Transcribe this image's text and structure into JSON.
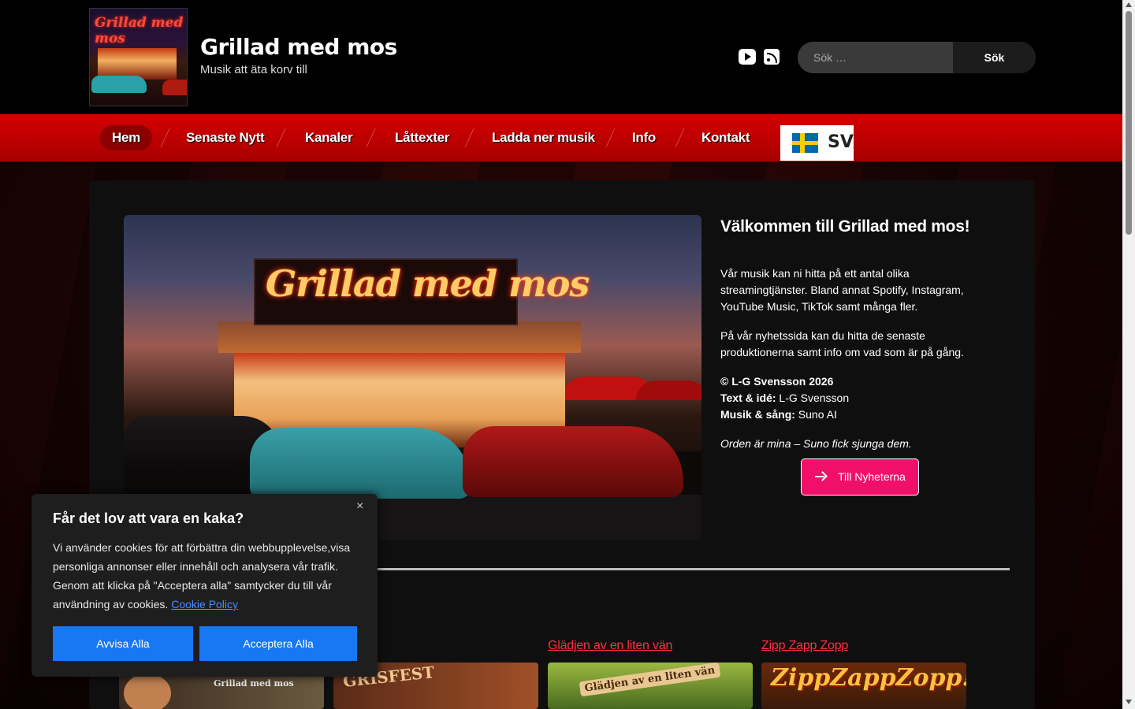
{
  "header": {
    "site_title": "Grillad med mos",
    "tagline": "Musik att äta korv till",
    "logo_text": "Grillad med mos",
    "social": [
      "youtube-icon",
      "rss-icon"
    ],
    "search": {
      "placeholder": "Sök …",
      "button_label": "Sök"
    }
  },
  "nav": {
    "items": [
      {
        "label": "Hem",
        "active": true
      },
      {
        "label": "Senaste Nytt"
      },
      {
        "label": "Kanaler"
      },
      {
        "label": "Låttexter"
      },
      {
        "label": "Ladda ner musik"
      },
      {
        "label": "Info"
      },
      {
        "label": "Kontakt"
      }
    ],
    "language": {
      "code": "SV",
      "flag": "sweden-flag-icon"
    }
  },
  "hero": {
    "image_sign_text": "Grillad med mos"
  },
  "welcome": {
    "title": "Välkommen till Grillad med mos!",
    "p1": "Vår musik kan ni hitta på ett antal olika streamingtjänster. Bland annat Spotify, Instagram, YouTube Music, TikTok samt många fler.",
    "p2": "På vår nyhetssida kan du hitta de senaste produktionerna samt info om vad som är på gång.",
    "copyright": "© L-G Svensson 2026",
    "text_label": "Text & idé:",
    "text_value": " L-G Svensson",
    "music_label": "Musik & sång:",
    "music_value": " Suno AI",
    "quote": "Orden är mina – Suno fick sjunga dem.",
    "button_label": "Till Nyheterna"
  },
  "posts": [
    {
      "title": "",
      "thumb_text": "Grillad med mos"
    },
    {
      "title": "",
      "thumb_text": "GRISFEST"
    },
    {
      "title": "Glädjen av en liten vän",
      "thumb_text": "Glädjen av en liten vän"
    },
    {
      "title": "Zipp Zapp Zopp",
      "thumb_text": "ZippZappZopp!"
    }
  ],
  "cookie": {
    "title": "Får det lov att vara en kaka?",
    "body": "Vi använder cookies för att förbättra din webbupplevelse,visa personliga annonser eller innehåll och analysera vår trafik. Genom att klicka på \"Acceptera alla\" samtycker du till vår användning av cookies. ",
    "policy_link": "Cookie Policy",
    "close": "×",
    "reject_label": "Avvisa Alla",
    "accept_label": "Acceptera Alla"
  },
  "colors": {
    "nav_red": "#c80000",
    "button_pink": "#f0106a",
    "link_red": "#ff3040",
    "cookie_button_blue": "#1877f2"
  }
}
